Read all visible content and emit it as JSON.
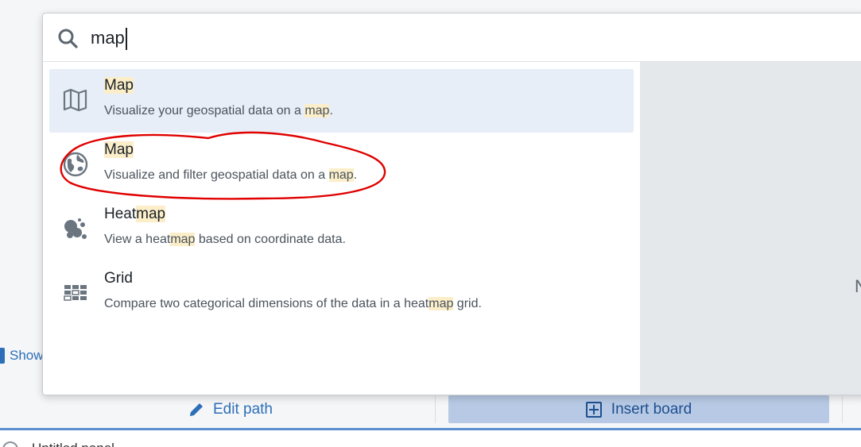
{
  "background": {
    "show_label": "Show",
    "edit_path_label": "Edit path",
    "insert_board_label": "Insert board",
    "bottom_text": "Untitled panel"
  },
  "search": {
    "query": "map"
  },
  "preview": {
    "glyph": "N"
  },
  "results": [
    {
      "icon": "map-icon",
      "title_pre": "",
      "title_hl": "Map",
      "title_post": "",
      "desc_pre": "Visualize your geospatial data on a ",
      "desc_hl": "map",
      "desc_post": ".",
      "selected": true
    },
    {
      "icon": "globe-icon",
      "title_pre": "",
      "title_hl": "Map",
      "title_post": "",
      "desc_pre": "Visualize and filter geospatial data on a ",
      "desc_hl": "map",
      "desc_post": ".",
      "selected": false,
      "annotated": true
    },
    {
      "icon": "heatmap-icon",
      "title_pre": "Heat",
      "title_hl": "map",
      "title_post": "",
      "desc_pre": "View a heat",
      "desc_hl": "map",
      "desc_post": " based on coordinate data.",
      "selected": false
    },
    {
      "icon": "grid-icon",
      "title_pre": "Grid",
      "title_hl": "",
      "title_post": "",
      "desc_pre": "Compare two categorical dimensions of the data in a heat",
      "desc_hl": "map",
      "desc_post": " grid.",
      "selected": false
    }
  ],
  "colors": {
    "selected_row": "#e7eef8",
    "highlight": "#fbeec9",
    "annotation": "#e00000",
    "accent": "#2d6fb8"
  }
}
